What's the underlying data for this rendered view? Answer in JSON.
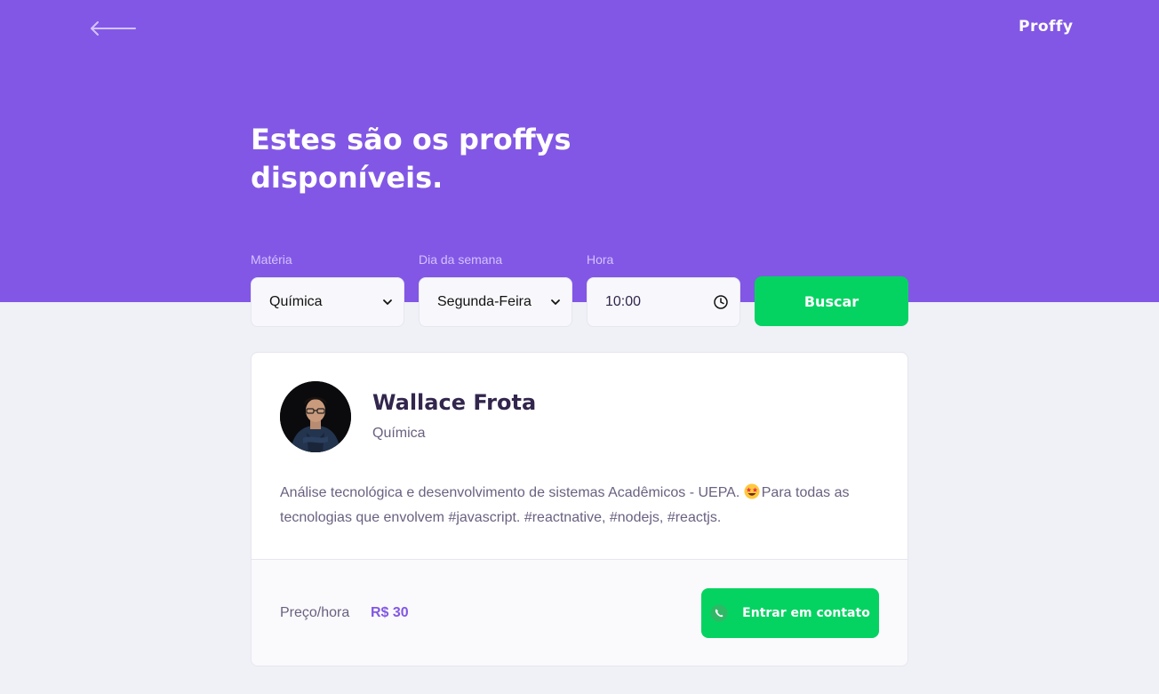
{
  "header": {
    "logo": "Proffy",
    "back_icon": "arrow-left-icon",
    "title": "Estes são os proffys disponíveis."
  },
  "filters": {
    "subject": {
      "label": "Matéria",
      "value": "Química"
    },
    "week_day": {
      "label": "Dia da semana",
      "value": "Segunda-Feira"
    },
    "time": {
      "label": "Hora",
      "value": "10:00"
    },
    "submit_label": "Buscar"
  },
  "teacher": {
    "name": "Wallace Frota",
    "subject": "Química",
    "bio_before_emoji": "Análise tecnológica e desenvolvimento de sistemas Acadêmicos - UEPA.",
    "bio_emoji_icon": "star-struck-emoji-icon",
    "bio_after_emoji": "Para todas as tecnologias que envolvem #javascript. #reactnative, #nodejs, #reactjs.",
    "price_label": "Preço/hora",
    "price": "R$ 30",
    "contact_label": "Entrar em contato",
    "contact_icon": "whatsapp-icon"
  },
  "colors": {
    "primary": "#8257E5",
    "secondary": "#04D361",
    "background": "#F0F0F7",
    "title_text": "#32264D",
    "body_text": "#6A6180",
    "label_text": "#D4C2FF"
  }
}
